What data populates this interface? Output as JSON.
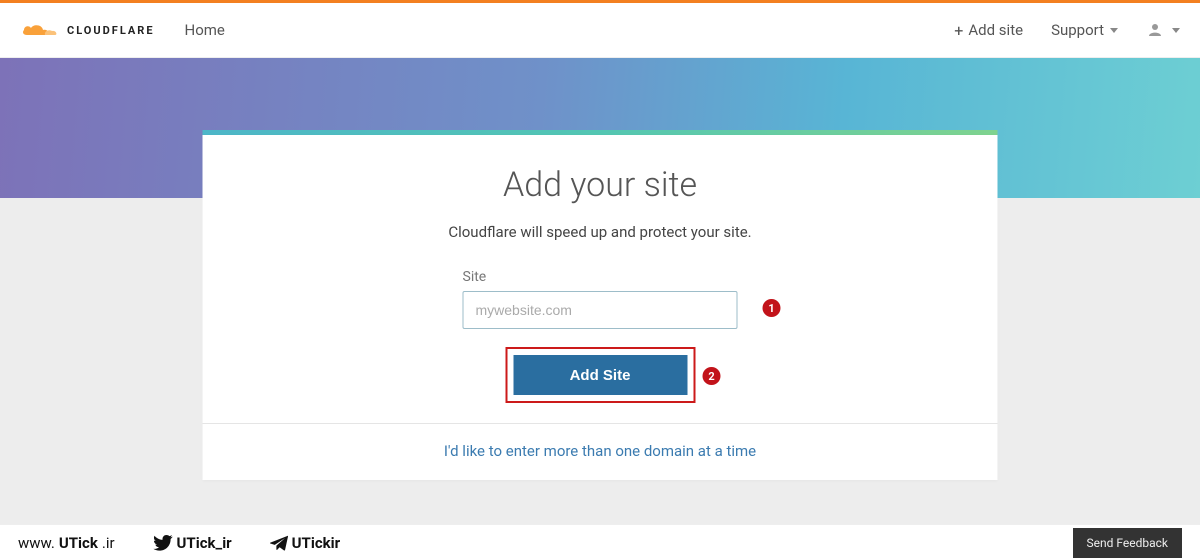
{
  "header": {
    "logo_text": "CLOUDFLARE",
    "nav_home": "Home",
    "add_site": "Add site",
    "support": "Support"
  },
  "card": {
    "title": "Add your site",
    "subtitle": "Cloudflare will speed up and protect your site.",
    "field_label": "Site",
    "placeholder": "mywebsite.com",
    "button": "Add Site",
    "multi_link": "I'd like to enter more than one domain at a time"
  },
  "markers": {
    "one": "1",
    "two": "2"
  },
  "footer": {
    "site1_thin": "www.",
    "site1_bold": "UTick",
    "site1_ext": ".ir",
    "site2": "UTick_ir",
    "site3": "UTickir",
    "feedback": "Send Feedback"
  }
}
